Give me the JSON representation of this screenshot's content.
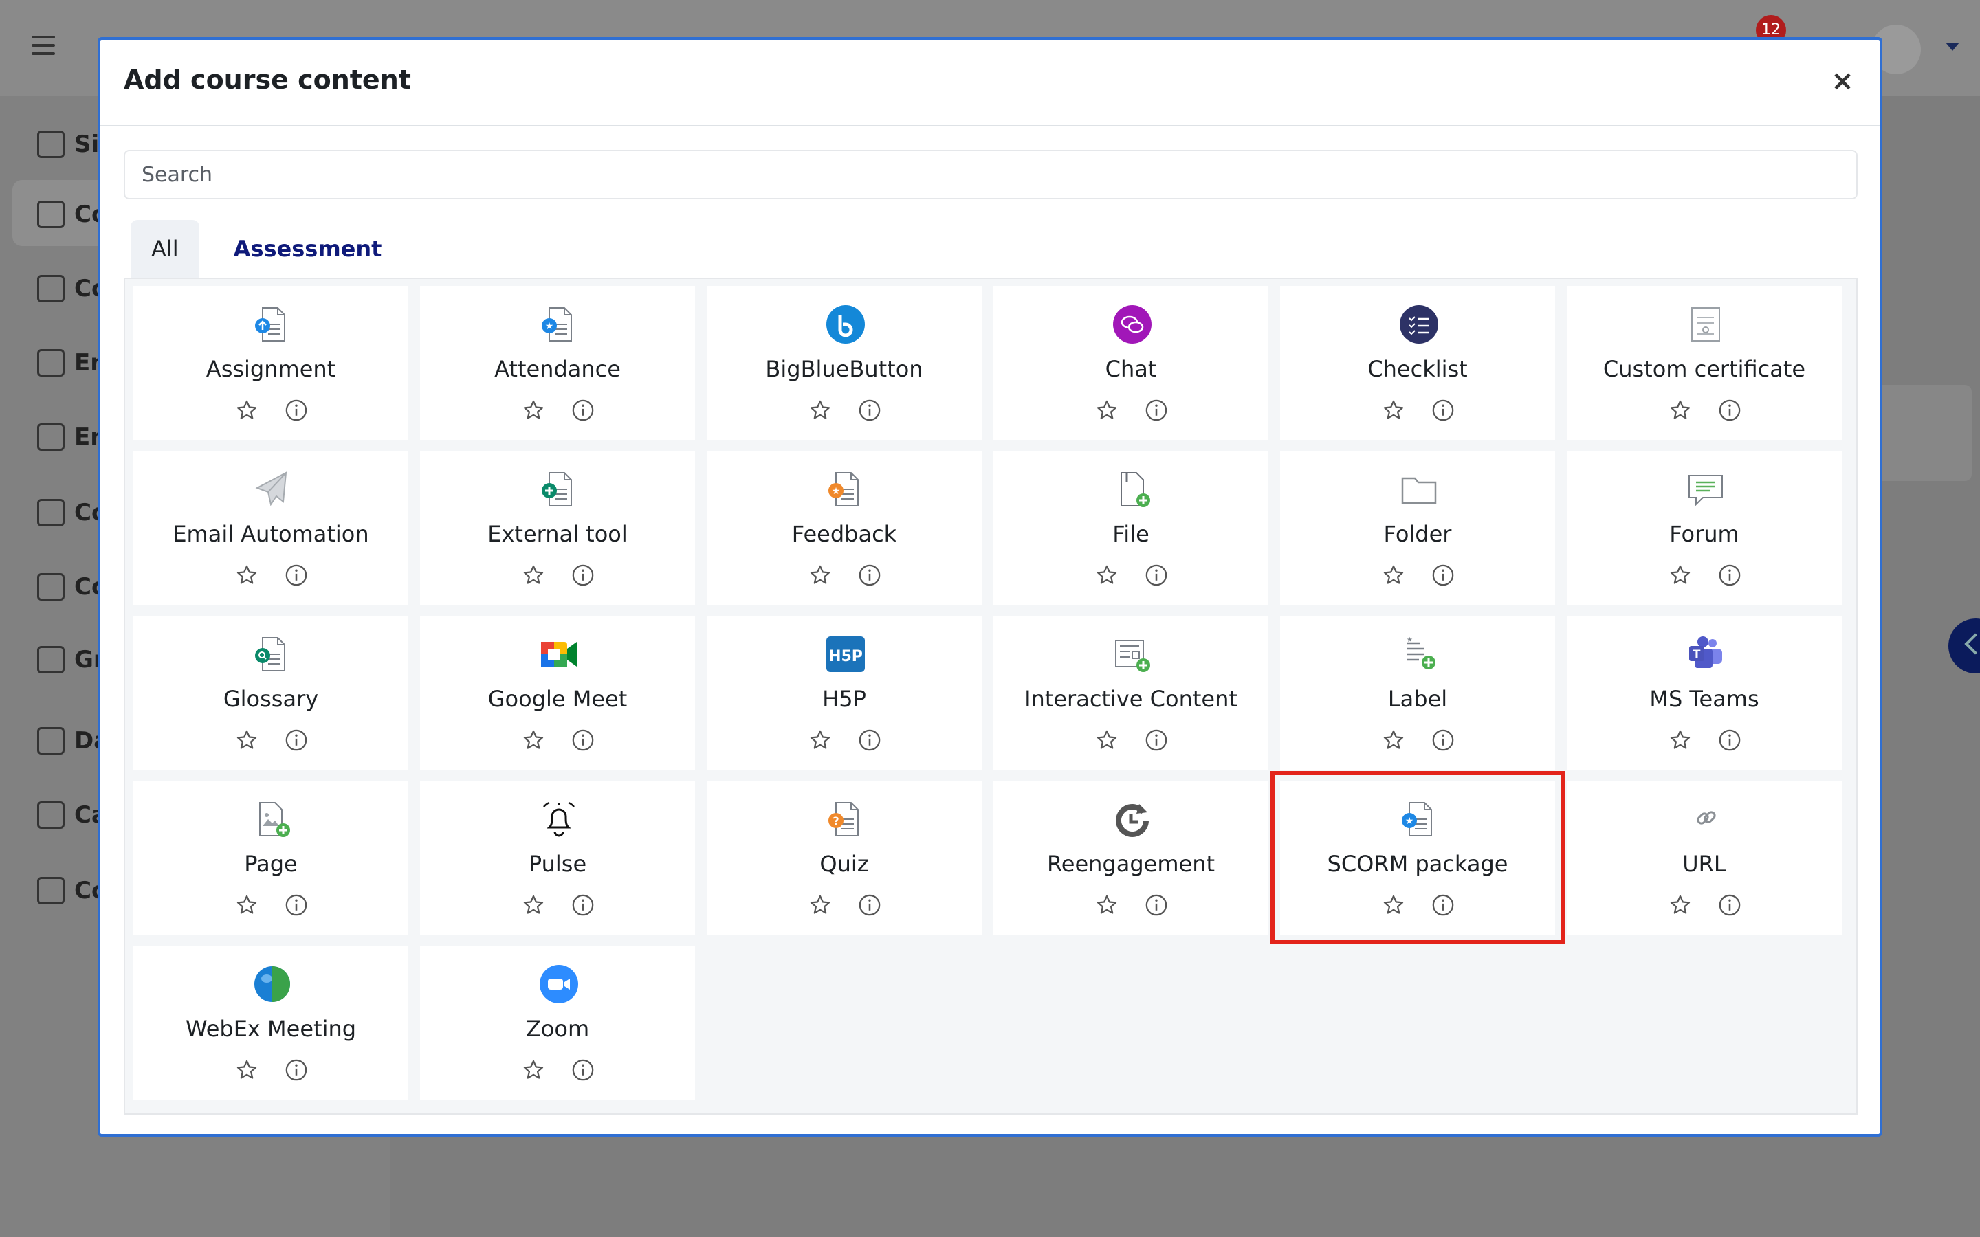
{
  "background": {
    "notification_count": "12",
    "sidebar_items": [
      "Sit",
      "Co",
      "Co",
      "En",
      "En",
      "Co",
      "Co",
      "Gr",
      "Da",
      "Ca",
      "Co"
    ]
  },
  "modal": {
    "title": "Add course content",
    "close_label": "×",
    "search_placeholder": "Search",
    "tabs": [
      {
        "label": "All",
        "active": true
      },
      {
        "label": "Assessment",
        "active": false
      }
    ]
  },
  "modules": [
    {
      "label": "Assignment",
      "icon": "assignment-icon",
      "color": "#1e88e5"
    },
    {
      "label": "Attendance",
      "icon": "attendance-icon",
      "color": "#1e88e5"
    },
    {
      "label": "BigBlueButton",
      "icon": "bigbluebutton-icon",
      "color": "#1488d8"
    },
    {
      "label": "Chat",
      "icon": "chat-icon",
      "color": "#a117b8"
    },
    {
      "label": "Checklist",
      "icon": "checklist-icon",
      "color": "#2d3266"
    },
    {
      "label": "Custom certificate",
      "icon": "certificate-icon",
      "color": "#9aa0a6"
    },
    {
      "label": "Email Automation",
      "icon": "paper-plane-icon",
      "color": "#9aa0a6"
    },
    {
      "label": "External tool",
      "icon": "external-tool-icon",
      "color": "#0b8a6a"
    },
    {
      "label": "Feedback",
      "icon": "feedback-icon",
      "color": "#f0892b"
    },
    {
      "label": "File",
      "icon": "file-icon",
      "color": "#4caf50"
    },
    {
      "label": "Folder",
      "icon": "folder-icon",
      "color": "#8a8f94"
    },
    {
      "label": "Forum",
      "icon": "forum-icon",
      "color": "#5bb15b"
    },
    {
      "label": "Glossary",
      "icon": "glossary-icon",
      "color": "#0b8a6a"
    },
    {
      "label": "Google Meet",
      "icon": "google-meet-icon",
      "color": "#34a853"
    },
    {
      "label": "H5P",
      "icon": "h5p-icon",
      "color": "#1b73ba"
    },
    {
      "label": "Interactive Content",
      "icon": "interactive-content-icon",
      "color": "#4caf50"
    },
    {
      "label": "Label",
      "icon": "label-icon",
      "color": "#4caf50"
    },
    {
      "label": "MS Teams",
      "icon": "ms-teams-icon",
      "color": "#5059c9"
    },
    {
      "label": "Page",
      "icon": "page-icon",
      "color": "#4caf50"
    },
    {
      "label": "Pulse",
      "icon": "bell-icon",
      "color": "#111111"
    },
    {
      "label": "Quiz",
      "icon": "quiz-icon",
      "color": "#f0892b"
    },
    {
      "label": "Reengagement",
      "icon": "reengagement-icon",
      "color": "#555555"
    },
    {
      "label": "SCORM package",
      "icon": "scorm-icon",
      "color": "#1e88e5",
      "highlighted": true
    },
    {
      "label": "URL",
      "icon": "link-icon",
      "color": "#8a8f94"
    },
    {
      "label": "WebEx Meeting",
      "icon": "webex-icon",
      "color": "#3aa24a"
    },
    {
      "label": "Zoom",
      "icon": "zoom-icon",
      "color": "#2d8cff"
    }
  ]
}
